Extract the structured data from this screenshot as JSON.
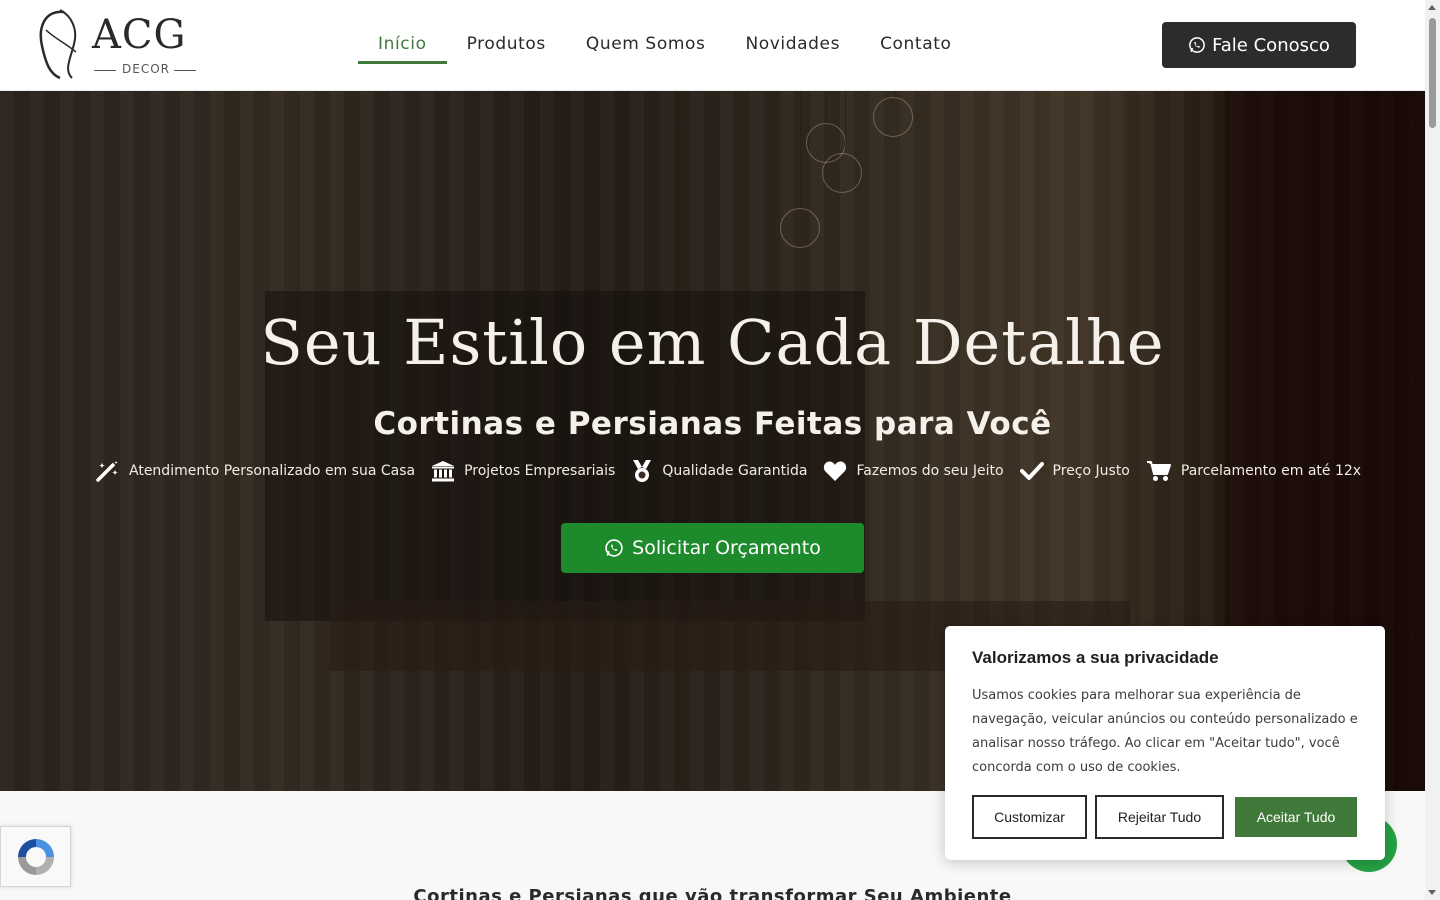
{
  "brand": {
    "name": "ACG",
    "tagline": "DECOR"
  },
  "nav": {
    "items": [
      {
        "label": "Início",
        "active": true
      },
      {
        "label": "Produtos",
        "active": false
      },
      {
        "label": "Quem Somos",
        "active": false
      },
      {
        "label": "Novidades",
        "active": false
      },
      {
        "label": "Contato",
        "active": false
      }
    ],
    "cta_label": "Fale Conosco"
  },
  "hero": {
    "title": "Seu Estilo em Cada Detalhe",
    "subtitle": "Cortinas e Persianas Feitas para Você",
    "features": [
      {
        "icon": "magic-wand-icon",
        "label": "Atendimento Personalizado em sua Casa"
      },
      {
        "icon": "bank-icon",
        "label": "Projetos Empresariais"
      },
      {
        "icon": "medal-icon",
        "label": "Qualidade Garantida"
      },
      {
        "icon": "heart-icon",
        "label": "Fazemos do seu Jeito"
      },
      {
        "icon": "check-icon",
        "label": "Preço Justo"
      },
      {
        "icon": "cart-icon",
        "label": "Parcelamento em até 12x"
      }
    ],
    "cta_label": "Solicitar Orçamento"
  },
  "section": {
    "heading": "Cortinas e Persianas que vão transformar Seu Ambiente"
  },
  "cookie": {
    "title": "Valorizamos a sua privacidade",
    "text": "Usamos cookies para melhorar sua experiência de navegação, veicular anúncios ou conteúdo personalizado e analisar nosso tráfego. Ao clicar em \"Aceitar tudo\", você concorda com o uso de cookies.",
    "customize_label": "Customizar",
    "reject_label": "Rejeitar Tudo",
    "accept_label": "Aceitar Tudo"
  },
  "colors": {
    "accent_green": "#3f7a3a",
    "cta_green": "#1d8a2c",
    "dark": "#2c2c2c",
    "whatsapp": "#25a244"
  }
}
